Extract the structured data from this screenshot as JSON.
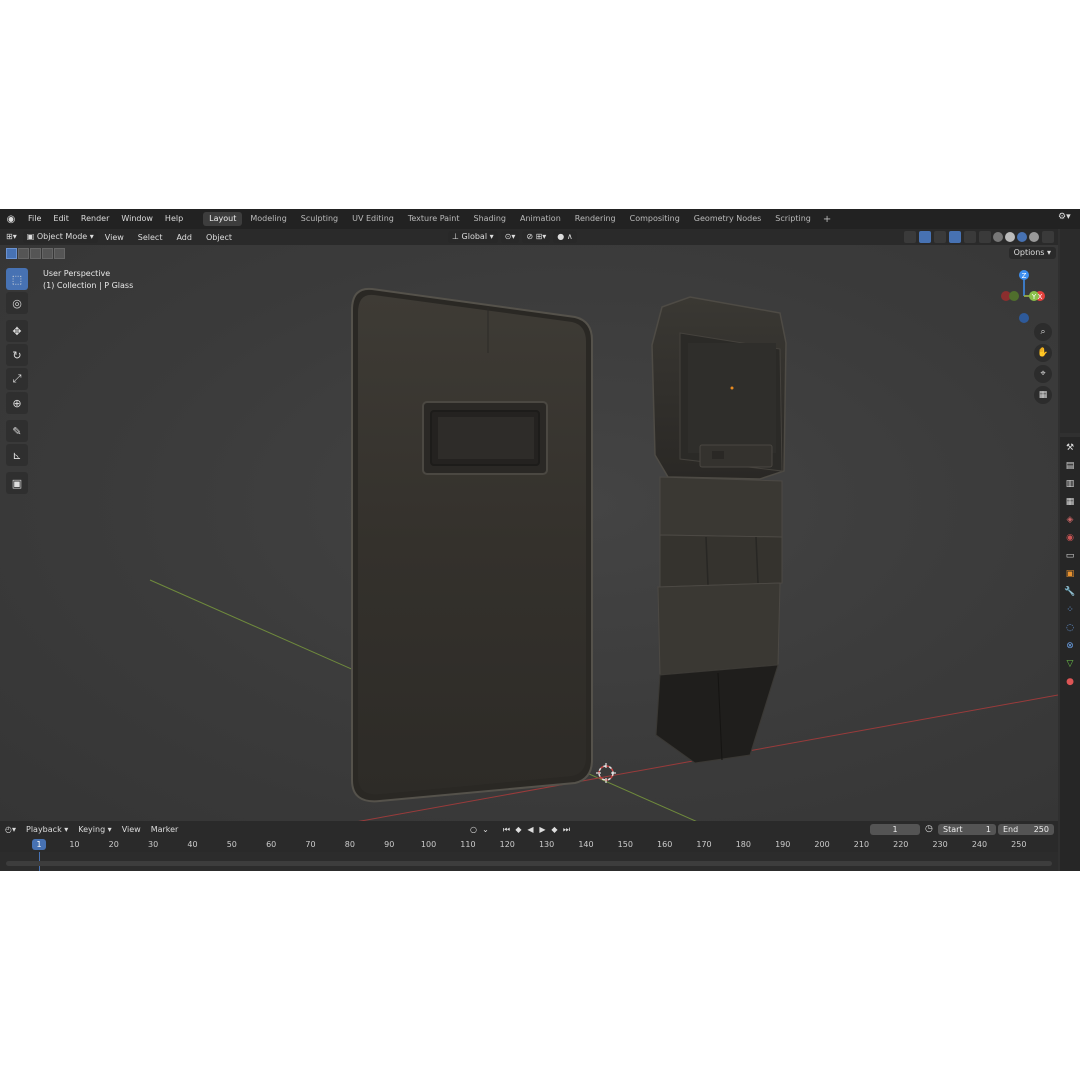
{
  "menubar": {
    "logo": "blender-logo-icon",
    "items": [
      "File",
      "Edit",
      "Render",
      "Window",
      "Help"
    ],
    "workspaces": [
      "Layout",
      "Modeling",
      "Sculpting",
      "UV Editing",
      "Texture Paint",
      "Shading",
      "Animation",
      "Rendering",
      "Compositing",
      "Geometry Nodes",
      "Scripting"
    ],
    "active_workspace": "Layout",
    "add_tab": "+"
  },
  "header": {
    "mode": "Object Mode",
    "menus": [
      "View",
      "Select",
      "Add",
      "Object"
    ],
    "transform_orientation": "Global"
  },
  "viewport": {
    "view_name": "User Perspective",
    "collection_info": "(1) Collection | P Glass",
    "options_label": "Options",
    "gizmo_axes": {
      "x": "X",
      "y": "Y",
      "z": "Z"
    },
    "colors": {
      "x_axis": "#e4413d",
      "y_axis": "#8ac04a",
      "z_axis": "#3d8ff0",
      "accent": "#4772b3"
    }
  },
  "toolbar": {
    "tools": [
      "select-box-icon",
      "cursor-icon",
      "move-icon",
      "rotate-icon",
      "scale-icon",
      "transform-icon",
      "annotate-icon",
      "measure-icon",
      "add-cube-icon"
    ]
  },
  "timeline": {
    "menus": [
      "Playback",
      "Keying",
      "View",
      "Marker"
    ],
    "current_frame": "1",
    "start_label": "Start",
    "start_value": "1",
    "end_label": "End",
    "end_value": "250",
    "ruler": [
      "10",
      "20",
      "30",
      "40",
      "50",
      "60",
      "70",
      "80",
      "90",
      "100",
      "110",
      "120",
      "130",
      "140",
      "150",
      "160",
      "170",
      "180",
      "190",
      "200",
      "210",
      "220",
      "230",
      "240",
      "250"
    ]
  }
}
